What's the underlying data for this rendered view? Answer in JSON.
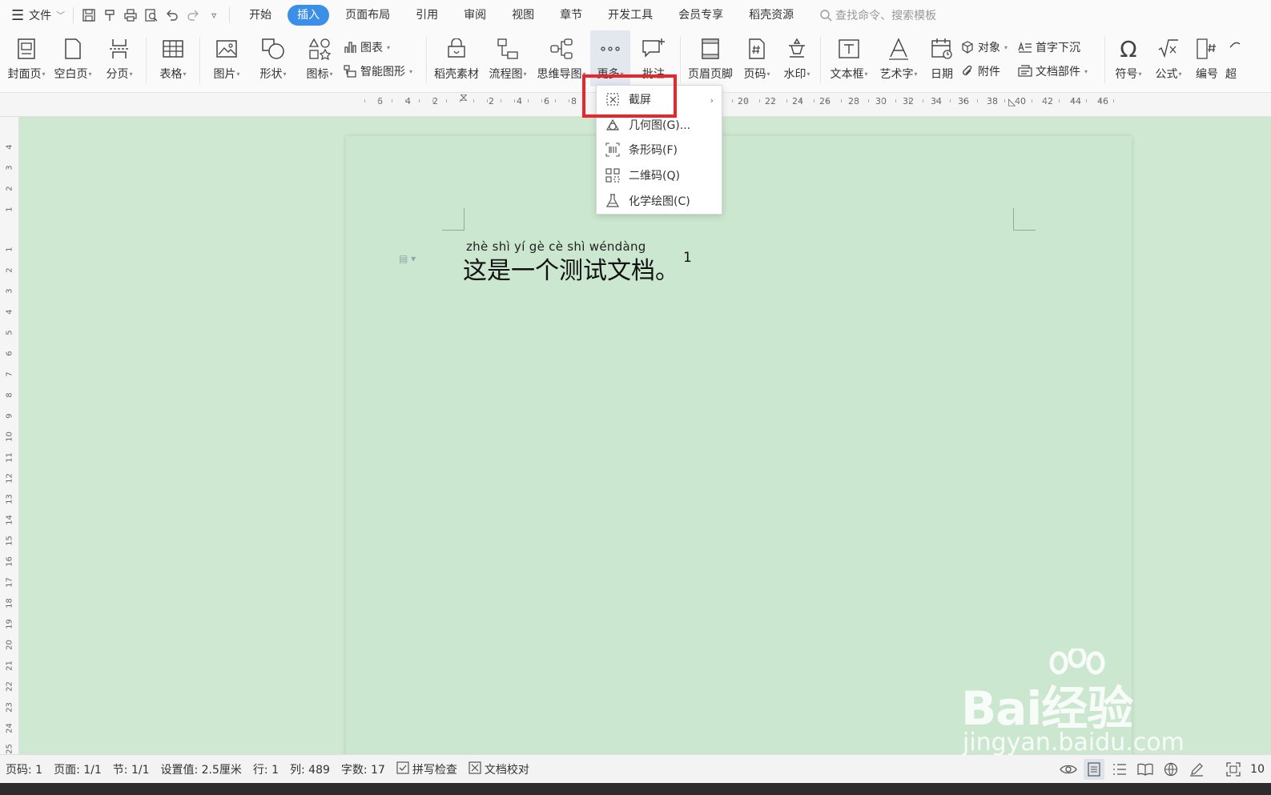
{
  "menubar": {
    "file_label": "文件",
    "tabs": [
      {
        "label": "开始"
      },
      {
        "label": "插入"
      },
      {
        "label": "页面布局"
      },
      {
        "label": "引用"
      },
      {
        "label": "审阅"
      },
      {
        "label": "视图"
      },
      {
        "label": "章节"
      },
      {
        "label": "开发工具"
      },
      {
        "label": "会员专享"
      },
      {
        "label": "稻壳资源"
      }
    ],
    "active_tab": "插入",
    "search_placeholder": "查找命令、搜索模板"
  },
  "ribbon": {
    "cover_page": "封面页",
    "blank_page": "空白页",
    "page_break": "分页",
    "table": "表格",
    "picture": "图片",
    "shape": "形状",
    "icon": "图标",
    "chart": "图表",
    "smart_art": "智能图形",
    "docer_assets": "稻壳素材",
    "flowchart": "流程图",
    "mind_map": "思维导图",
    "more": "更多",
    "comment": "批注",
    "header_footer": "页眉页脚",
    "page_number": "页码",
    "watermark": "水印",
    "text_box": "文本框",
    "word_art": "艺术字",
    "date": "日期",
    "object": "对象",
    "attachment": "附件",
    "drop_cap": "首字下沉",
    "doc_parts": "文档部件",
    "symbol": "符号",
    "formula": "公式",
    "numbering": "编号",
    "hyperlink": "超"
  },
  "ruler": {
    "labels": [
      "6",
      "4",
      "2",
      "2",
      "4",
      "6",
      "8",
      "20",
      "22",
      "24",
      "26",
      "28",
      "30",
      "32",
      "34",
      "36",
      "38",
      "40",
      "42",
      "44",
      "46"
    ],
    "vlabels": [
      "4",
      "3",
      "2",
      "1",
      "1",
      "2",
      "3",
      "4",
      "5",
      "6",
      "7",
      "8",
      "9",
      "10",
      "11",
      "12",
      "13",
      "14",
      "15",
      "16",
      "17",
      "18",
      "19",
      "20",
      "21",
      "22",
      "23",
      "24",
      "25"
    ]
  },
  "document": {
    "pinyin": "zhè  shì   yí   gè   cè   shì wéndàng",
    "text": "这是一个测试文档。",
    "superscript": "1"
  },
  "dropdown": {
    "items": [
      {
        "label": "截屏",
        "icon": "screenshot-icon"
      },
      {
        "label": "几何图(G)...",
        "icon": "geometry-icon"
      },
      {
        "label": "条形码(F)",
        "icon": "barcode-icon"
      },
      {
        "label": "二维码(Q)",
        "icon": "qrcode-icon"
      },
      {
        "label": "化学绘图(C)",
        "icon": "flask-icon"
      }
    ]
  },
  "statusbar": {
    "page_num": "页码: 1",
    "pages": "页面: 1/1",
    "section": "节: 1/1",
    "setting": "设置值: 2.5厘米",
    "row": "行: 1",
    "col": "列: 489",
    "word_count": "字数: 17",
    "spell_check": "拼写检查",
    "doc_proof": "文档校对",
    "zoom": "10"
  },
  "watermark": {
    "logo": "Bai经验",
    "url": "jingyan.baidu.com"
  },
  "colors": {
    "accent": "#3b8fe8",
    "highlight_box": "#e8262c",
    "page_bg": "#cce7cf"
  }
}
